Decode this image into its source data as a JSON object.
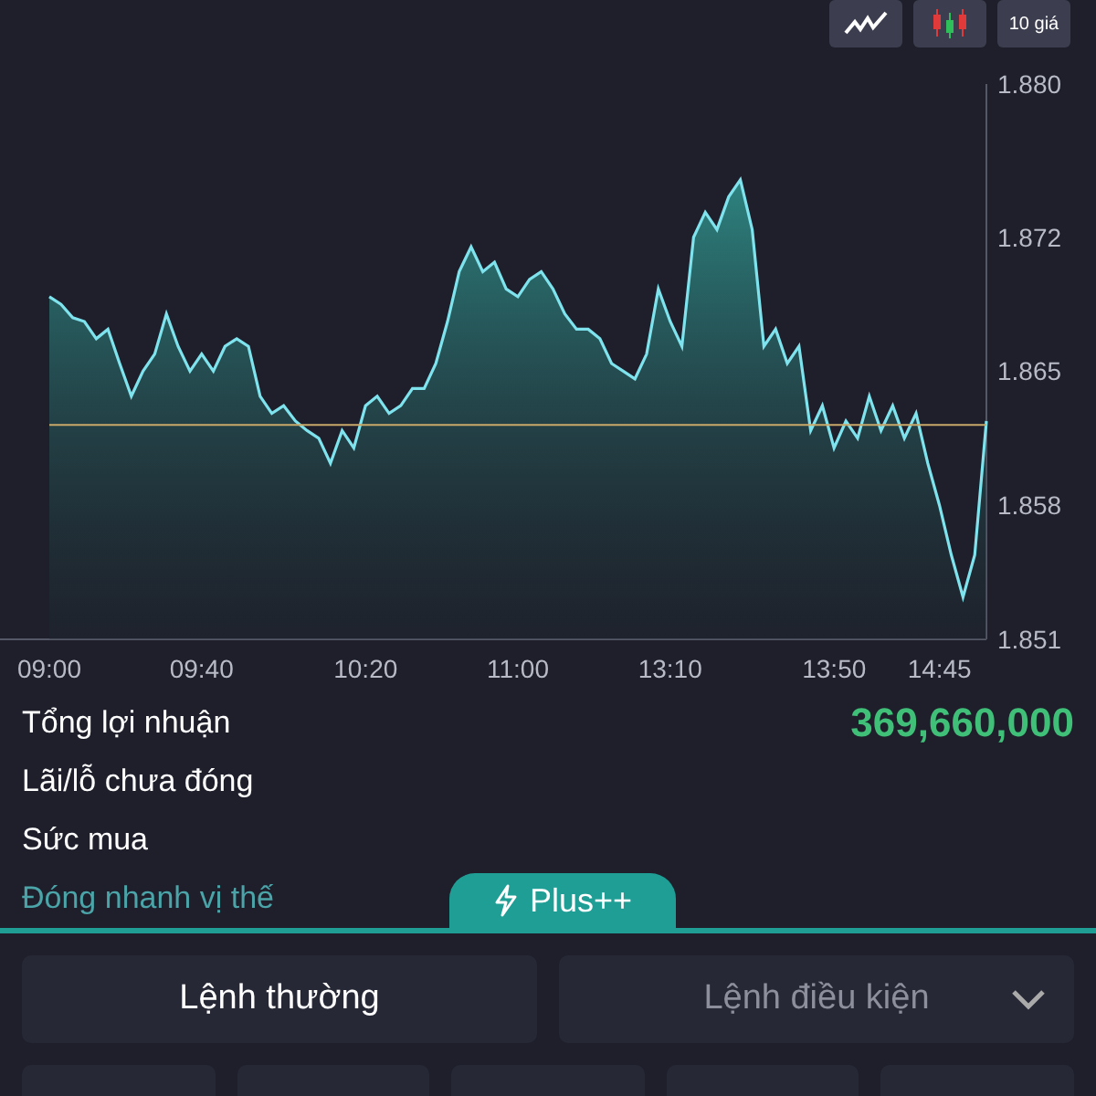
{
  "chart_toolbar": {
    "buttons": [
      {
        "kind": "line"
      },
      {
        "kind": "candles"
      },
      {
        "kind": "text",
        "label": "10 giá"
      }
    ]
  },
  "chart_data": {
    "type": "area",
    "ylim": [
      1.851,
      1.88
    ],
    "yticks": [
      1.851,
      1.858,
      1.865,
      1.872,
      {
        "value": 1.88,
        "label": "1.880"
      }
    ],
    "categories": [
      "09:00",
      null,
      null,
      null,
      null,
      null,
      null,
      null,
      null,
      null,
      null,
      null,
      null,
      "09:40",
      null,
      null,
      null,
      null,
      null,
      null,
      null,
      null,
      null,
      null,
      null,
      null,
      null,
      "10:20",
      null,
      null,
      null,
      null,
      null,
      null,
      null,
      null,
      null,
      null,
      null,
      null,
      "11:00",
      null,
      null,
      null,
      null,
      null,
      null,
      null,
      null,
      null,
      null,
      null,
      null,
      "13:10",
      null,
      null,
      null,
      null,
      null,
      null,
      null,
      null,
      null,
      null,
      null,
      null,
      null,
      "13:50",
      null,
      null,
      null,
      null,
      null,
      null,
      null,
      null,
      "14:45",
      null,
      null,
      null,
      null
    ],
    "series": [
      {
        "color": "#7fe3ee",
        "values": [
          1.8689,
          1.8685,
          1.8678,
          1.8676,
          1.8667,
          1.8672,
          1.8654,
          1.8637,
          1.865,
          1.8659,
          1.868,
          1.8663,
          1.865,
          1.8659,
          1.865,
          1.8663,
          1.8667,
          1.8663,
          1.8637,
          1.8628,
          1.8632,
          1.8624,
          1.8619,
          1.8615,
          1.8602,
          1.8619,
          1.861,
          1.8632,
          1.8637,
          1.8628,
          1.8632,
          1.8641,
          1.8641,
          1.8654,
          1.8676,
          1.8702,
          1.8715,
          1.8702,
          1.8707,
          1.8693,
          1.8689,
          1.8698,
          1.8702,
          1.8693,
          1.868,
          1.8672,
          1.8672,
          1.8667,
          1.8654,
          1.865,
          1.8646,
          1.8659,
          1.8693,
          1.8676,
          1.8663,
          1.872,
          1.8733,
          1.8724,
          1.8741,
          1.875,
          1.8724,
          1.8663,
          1.8672,
          1.8654,
          1.8663,
          1.8619,
          1.8632,
          1.861,
          1.8624,
          1.8615,
          1.8637,
          1.8619,
          1.8632,
          1.8615,
          1.8628,
          1.8602,
          1.858,
          1.8554,
          1.8532,
          1.8554,
          1.8624
        ]
      },
      {
        "type": "line",
        "color": "#c9a96a",
        "values": [
          1.8622,
          1.8622,
          1.8622,
          1.8622,
          1.8622,
          1.8622,
          1.8622,
          1.8622,
          1.8622,
          1.8622,
          1.8622,
          1.8622,
          1.8622,
          1.8622,
          1.8622,
          1.8622,
          1.8622,
          1.8622,
          1.8622,
          1.8622,
          1.8622,
          1.8622,
          1.8622,
          1.8622,
          1.8622,
          1.8622,
          1.8622,
          1.8622,
          1.8622,
          1.8622,
          1.8622,
          1.8622,
          1.8622,
          1.8622,
          1.8622,
          1.8622,
          1.8622,
          1.8622,
          1.8622,
          1.8622,
          1.8622,
          1.8622,
          1.8622,
          1.8622,
          1.8622,
          1.8622,
          1.8622,
          1.8622,
          1.8622,
          1.8622,
          1.8622,
          1.8622,
          1.8622,
          1.8622,
          1.8622,
          1.8622,
          1.8622,
          1.8622,
          1.8622,
          1.8622,
          1.8622,
          1.8622,
          1.8622,
          1.8622,
          1.8622,
          1.8622,
          1.8622,
          1.8622,
          1.8622,
          1.8622,
          1.8622,
          1.8622,
          1.8622,
          1.8622,
          1.8622,
          1.8622,
          1.8622,
          1.8622,
          1.8622,
          1.8622,
          1.8622
        ]
      }
    ]
  },
  "summary": {
    "rows": [
      {
        "label": "Tổng lợi nhuận",
        "value": "369,660,000"
      },
      {
        "label": "Lãi/lỗ chưa đóng"
      },
      {
        "label": "Sức mua"
      }
    ],
    "link": "Đóng nhanh vị thế",
    "plus_tab": "Plus++"
  },
  "order_tabs": [
    {
      "label": "Lệnh thường",
      "selected": true,
      "dropdown": false
    },
    {
      "label": "Lệnh điều kiện",
      "selected": false,
      "dropdown": true
    }
  ]
}
